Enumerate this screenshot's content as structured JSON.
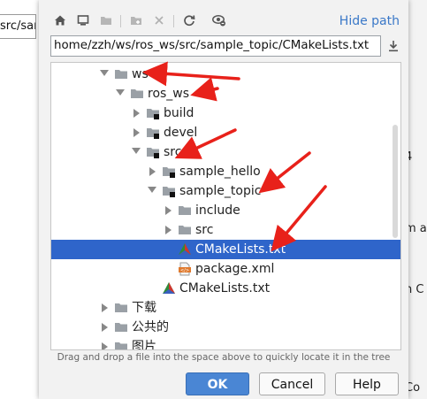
{
  "background": {
    "left_path_fragment": "src/samp",
    "right_fragments": [
      "4",
      "m a",
      "n C",
      "Co"
    ]
  },
  "toolbar": {
    "hide_path_label": "Hide path",
    "icons": [
      "home-icon",
      "desktop-icon",
      "project-folder-icon",
      "new-folder-icon",
      "delete-icon",
      "refresh-icon",
      "show-hidden-icon"
    ]
  },
  "path": {
    "value": "home/zzh/ws/ros_ws/src/sample_topic/CMakeLists.txt"
  },
  "tree": {
    "rows": [
      {
        "label": "ws",
        "type": "folder",
        "expanded": true
      },
      {
        "label": "ros_ws",
        "type": "folder",
        "expanded": true
      },
      {
        "label": "build",
        "type": "folder-module",
        "expanded": false
      },
      {
        "label": "devel",
        "type": "folder-module",
        "expanded": false
      },
      {
        "label": "src",
        "type": "folder-module",
        "expanded": true
      },
      {
        "label": "sample_hello",
        "type": "folder-module",
        "expanded": false
      },
      {
        "label": "sample_topic",
        "type": "folder-module",
        "expanded": true
      },
      {
        "label": "include",
        "type": "folder",
        "expanded": false
      },
      {
        "label": "src",
        "type": "folder",
        "expanded": false
      },
      {
        "label": "CMakeLists.txt",
        "type": "cmake-file",
        "selected": true
      },
      {
        "label": "package.xml",
        "type": "xml-file"
      },
      {
        "label": "CMakeLists.txt",
        "type": "cmake-file"
      },
      {
        "label": "下载",
        "type": "folder",
        "expanded": false
      },
      {
        "label": "公共的",
        "type": "folder",
        "expanded": false
      },
      {
        "label": "图片",
        "type": "folder",
        "expanded": false
      }
    ]
  },
  "hint": "Drag and drop a file into the space above to quickly locate it in the tree",
  "buttons": {
    "ok": "OK",
    "cancel": "Cancel",
    "help": "Help"
  },
  "colors": {
    "selection": "#2f65ca",
    "link": "#3a78c8",
    "annotation_arrow": "#e8211a",
    "ok_button": "#4a86d4"
  }
}
